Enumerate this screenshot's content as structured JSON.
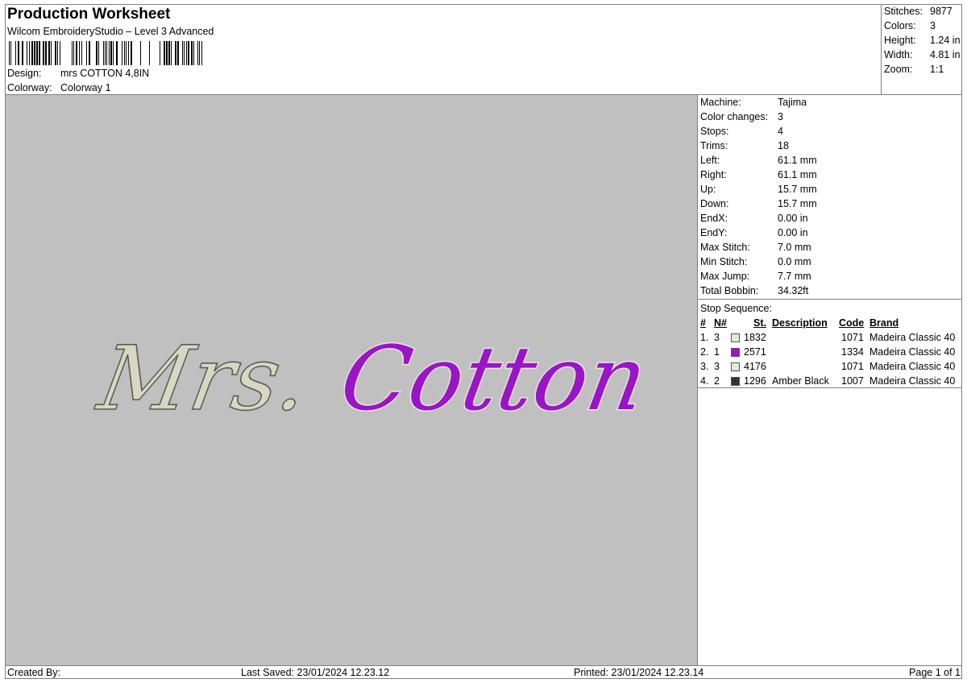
{
  "header": {
    "title": "Production Worksheet",
    "subtitle": "Wilcom EmbroideryStudio – Level 3 Advanced",
    "design_label": "Design:",
    "design_value": "mrs COTTON 4,8IN",
    "colorway_label": "Colorway:",
    "colorway_value": "Colorway 1"
  },
  "summary": [
    {
      "label": "Stitches:",
      "value": "9877"
    },
    {
      "label": "Colors:",
      "value": "3"
    },
    {
      "label": "Height:",
      "value": "1.24 in"
    },
    {
      "label": "Width:",
      "value": "4.81 in"
    },
    {
      "label": "Zoom:",
      "value": "1:1"
    }
  ],
  "stats": [
    {
      "label": "Machine:",
      "value": "Tajima"
    },
    {
      "label": "Color changes:",
      "value": "3"
    },
    {
      "label": "Stops:",
      "value": "4"
    },
    {
      "label": "Trims:",
      "value": "18"
    },
    {
      "label": "Left:",
      "value": "61.1 mm"
    },
    {
      "label": "Right:",
      "value": "61.1 mm"
    },
    {
      "label": "Up:",
      "value": "15.7 mm"
    },
    {
      "label": "Down:",
      "value": "15.7 mm"
    },
    {
      "label": "EndX:",
      "value": "0.00 in"
    },
    {
      "label": "EndY:",
      "value": "0.00 in"
    },
    {
      "label": "Max Stitch:",
      "value": "7.0 mm"
    },
    {
      "label": "Min Stitch:",
      "value": "0.0 mm"
    },
    {
      "label": "Max Jump:",
      "value": "7.7 mm"
    },
    {
      "label": "Total Bobbin:",
      "value": "34.32ft"
    }
  ],
  "stop_sequence": {
    "title": "Stop Sequence:",
    "headers": {
      "num": "#",
      "n": "N#",
      "st": "St.",
      "description": "Description",
      "code": "Code",
      "brand": "Brand"
    },
    "rows": [
      {
        "num": "1.",
        "n": "3",
        "color": "#e6e6dc",
        "st": "1832",
        "description": "",
        "code": "1071",
        "brand": "Madeira Classic 40"
      },
      {
        "num": "2.",
        "n": "1",
        "color": "#9a14c8",
        "st": "2571",
        "description": "",
        "code": "1334",
        "brand": "Madeira Classic 40"
      },
      {
        "num": "3.",
        "n": "3",
        "color": "#e6e6dc",
        "st": "4176",
        "description": "",
        "code": "1071",
        "brand": "Madeira Classic 40"
      },
      {
        "num": "4.",
        "n": "2",
        "color": "#333333",
        "st": "1296",
        "description": "Amber Black",
        "code": "1007",
        "brand": "Madeira Classic 40"
      }
    ]
  },
  "preview": {
    "text_left": "Mrs.",
    "text_right": "Cotton",
    "background": "#c0c0c0",
    "thread_light": "#d6d8c4",
    "thread_purple": "#9a14c8",
    "thread_dark": "#333333"
  },
  "footer": {
    "created_by": "Created By:",
    "last_saved": "Last Saved: 23/01/2024 12.23.12",
    "printed": "Printed: 23/01/2024 12.23.14",
    "page": "Page 1 of 1"
  }
}
